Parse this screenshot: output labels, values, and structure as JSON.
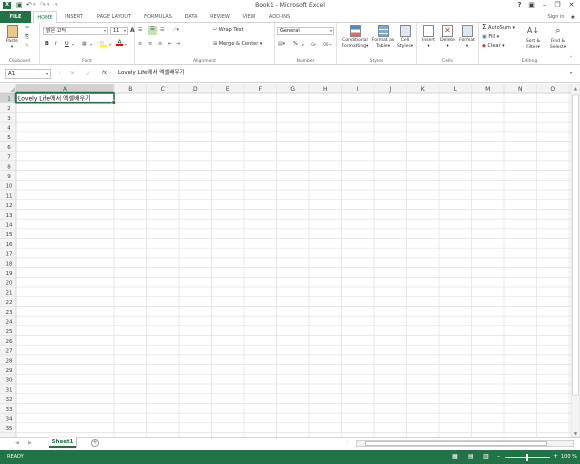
{
  "app": {
    "title": "Book1 - Microsoft Excel",
    "help": "?",
    "sign_in": "Sign in"
  },
  "tabs": [
    "FILE",
    "HOME",
    "INSERT",
    "PAGE LAYOUT",
    "FORMULAS",
    "DATA",
    "REVIEW",
    "VIEW",
    "ADD-INS"
  ],
  "ribbon": {
    "clipboard": {
      "label": "Clipboard",
      "paste": "Paste"
    },
    "font": {
      "label": "Font",
      "name": "맑은 고딕",
      "size": "11",
      "bold": "B",
      "italic": "I",
      "underline": "U",
      "grow": "A",
      "shrink": "A"
    },
    "alignment": {
      "label": "Alignment",
      "wrap": "Wrap Text",
      "merge": "Merge & Center"
    },
    "number": {
      "label": "Number",
      "format": "General",
      "percent": "%",
      "comma": ","
    },
    "styles": {
      "label": "Styles",
      "conditional": [
        "Conditional",
        "Formatting"
      ],
      "format_table": [
        "Format as",
        "Table"
      ],
      "cell_styles": [
        "Cell",
        "Styles"
      ]
    },
    "cells": {
      "label": "Cells",
      "insert": "Insert",
      "delete": "Delete",
      "format": "Format"
    },
    "editing": {
      "label": "Editing",
      "autosum": "AutoSum",
      "fill": "Fill",
      "clear": "Clear",
      "sort": [
        "Sort &",
        "Filter"
      ],
      "find": [
        "Find &",
        "Select"
      ]
    }
  },
  "formula_bar": {
    "name_box": "A1",
    "fx": "fx",
    "content": "Lovely Life에서 엑셀배우기"
  },
  "grid": {
    "columns": [
      "A",
      "B",
      "C",
      "D",
      "E",
      "F",
      "G",
      "H",
      "I",
      "J",
      "K",
      "L",
      "M",
      "N",
      "O"
    ],
    "rows": [
      "1",
      "2",
      "3",
      "4",
      "5",
      "6",
      "7",
      "8",
      "9",
      "10",
      "11",
      "12",
      "13",
      "14",
      "15",
      "16",
      "17",
      "18",
      "19",
      "20",
      "21",
      "22",
      "23",
      "24",
      "25",
      "26",
      "27",
      "28",
      "29",
      "30",
      "31",
      "32",
      "33",
      "34",
      "35"
    ],
    "cells": {
      "A1": "Lovely Life에서 엑셀배우기"
    },
    "selected": "A1"
  },
  "sheets": [
    "Sheet1"
  ],
  "status": {
    "ready": "READY",
    "zoom": "100 %"
  },
  "colors": {
    "accent": "#217346",
    "grid": "#e1e1e1",
    "header_bg": "#f3f3f3"
  }
}
